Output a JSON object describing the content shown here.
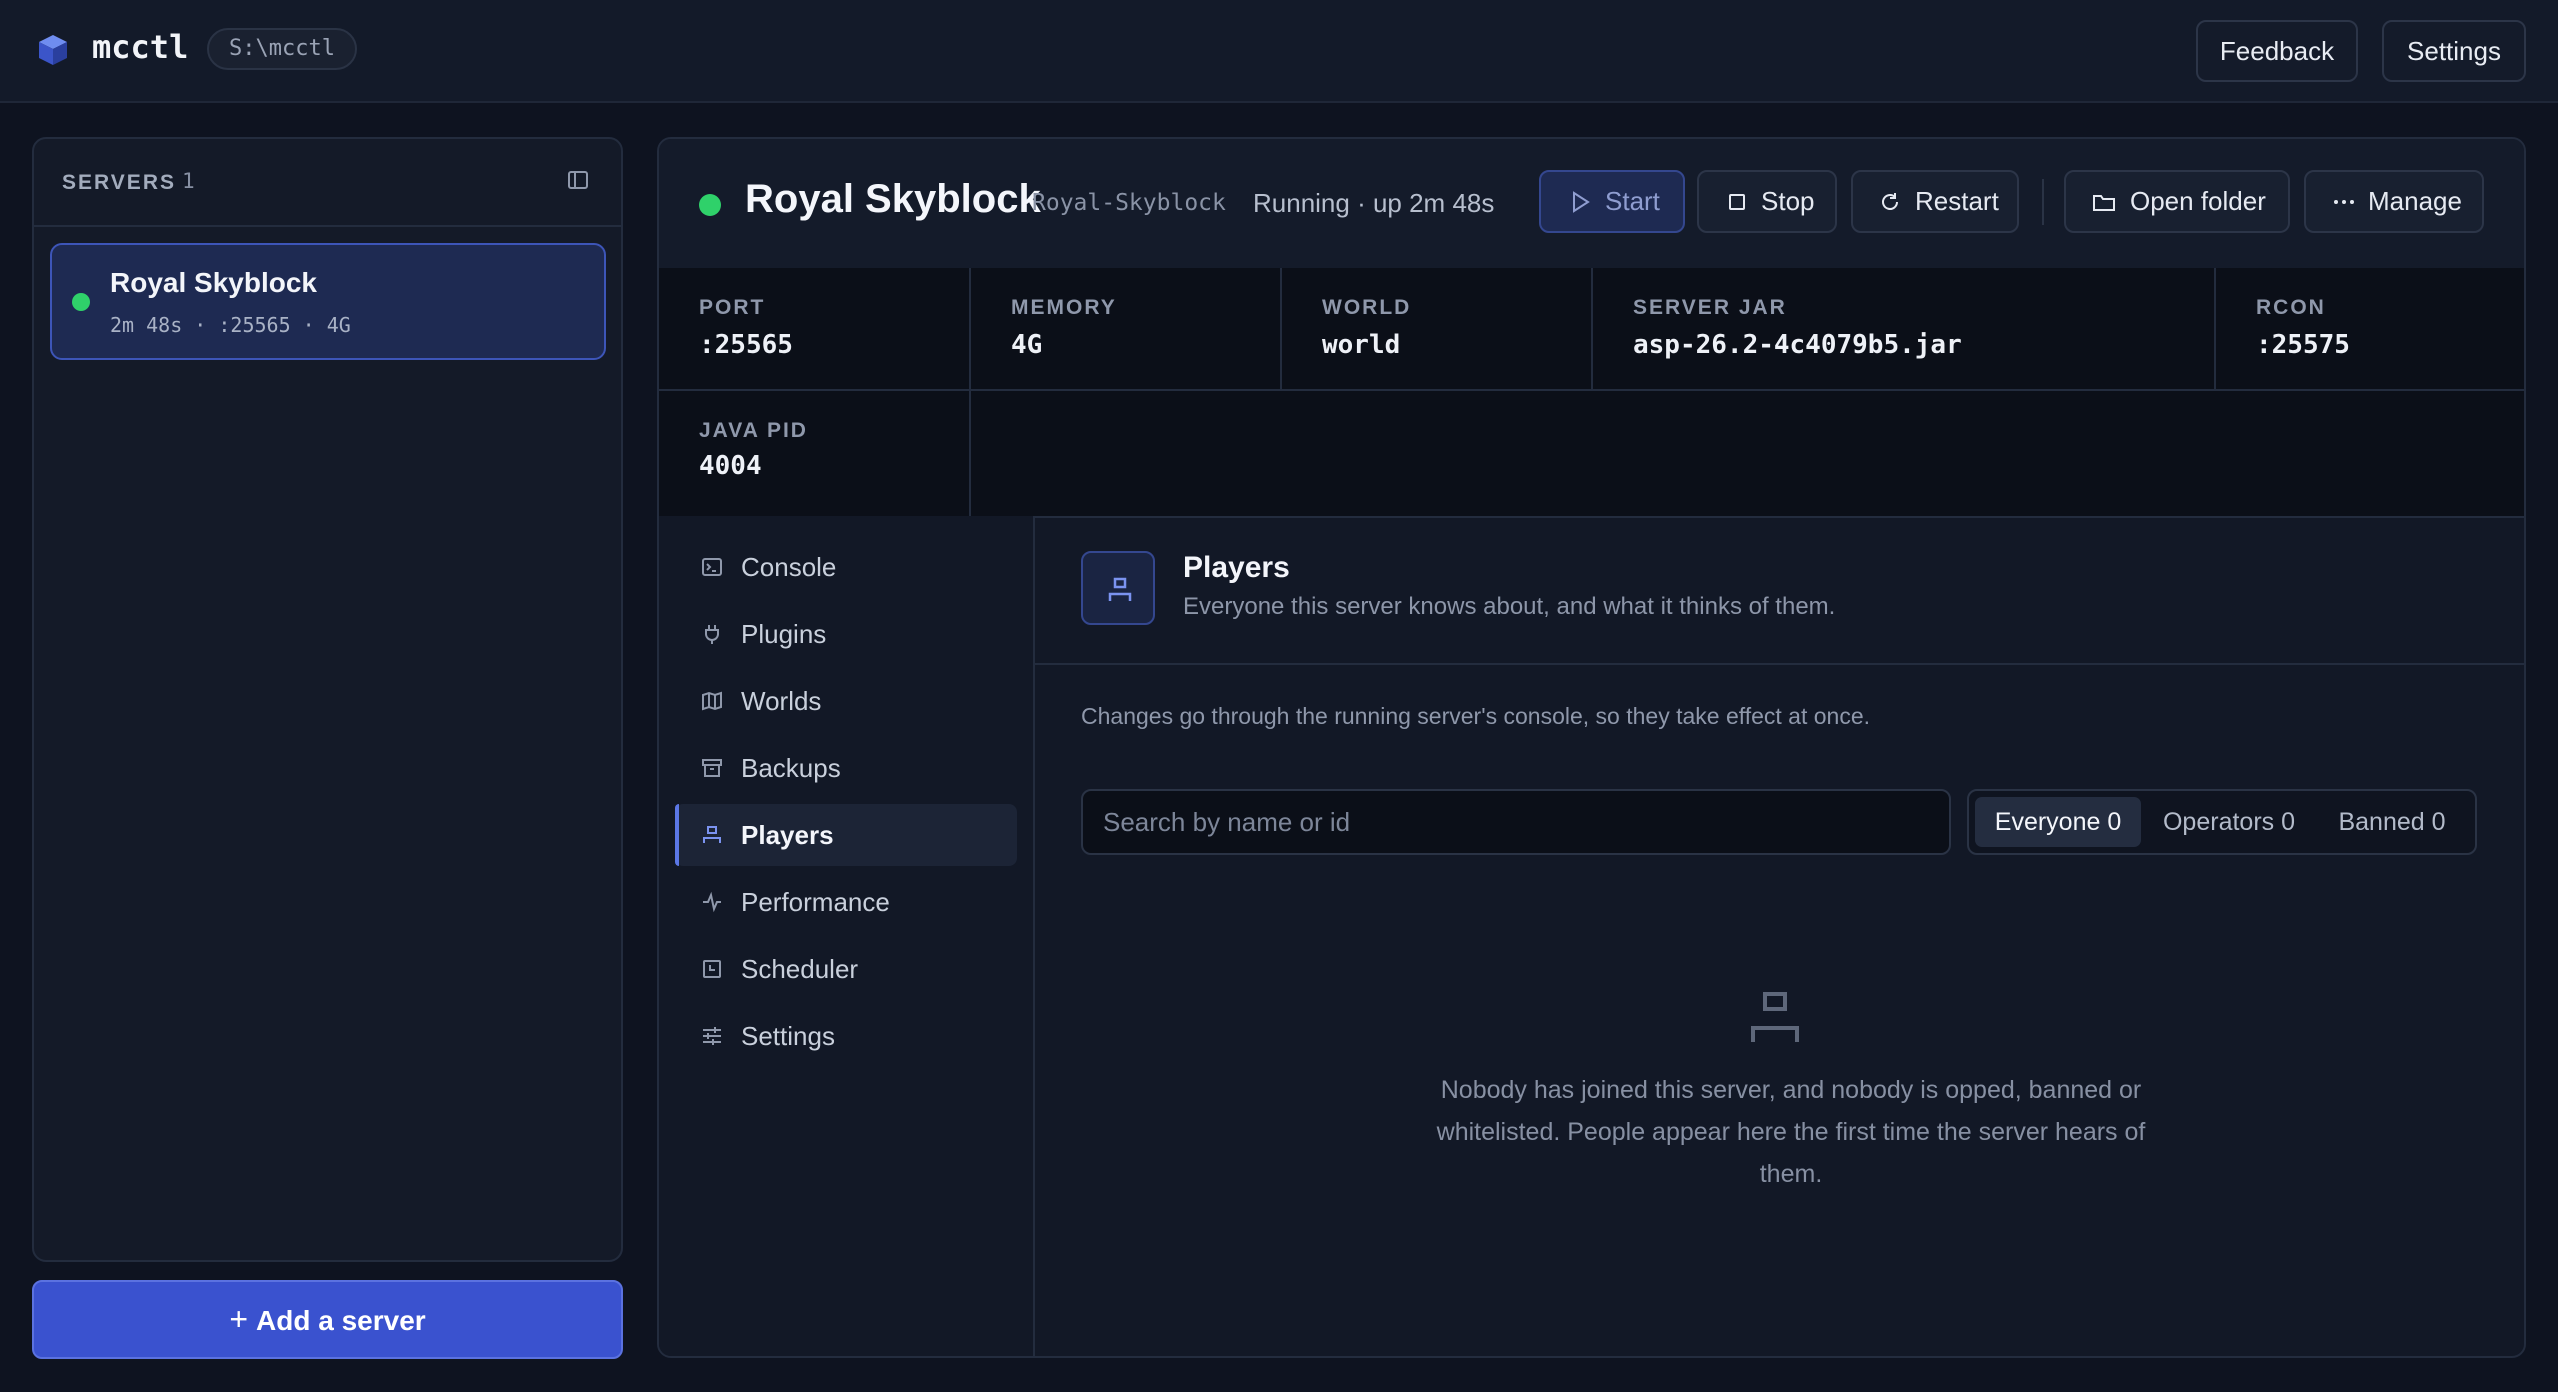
{
  "app": {
    "title": "mcctl",
    "path": "S:\\mcctl",
    "feedback_label": "Feedback",
    "settings_label": "Settings"
  },
  "sidebar": {
    "title": "SERVERS",
    "count": "1",
    "servers": [
      {
        "name": "Royal Skyblock",
        "meta": "2m 48s · :25565 · 4G",
        "status_color": "#2fd16a"
      }
    ],
    "add_label": "Add a server"
  },
  "server": {
    "name": "Royal Skyblock",
    "id": "Royal-Skyblock",
    "status": "Running · up 2m 48s",
    "actions": {
      "start": "Start",
      "stop": "Stop",
      "restart": "Restart",
      "open_folder": "Open folder",
      "manage": "Manage"
    },
    "stats": [
      {
        "label": "PORT",
        "value": ":25565"
      },
      {
        "label": "MEMORY",
        "value": "4G"
      },
      {
        "label": "WORLD",
        "value": "world"
      },
      {
        "label": "SERVER JAR",
        "value": "asp-26.2-4c4079b5.jar"
      },
      {
        "label": "RCON",
        "value": ":25575"
      },
      {
        "label": "JAVA PID",
        "value": "4004"
      }
    ]
  },
  "tabs": [
    {
      "label": "Console",
      "icon": "terminal-icon"
    },
    {
      "label": "Plugins",
      "icon": "plug-icon"
    },
    {
      "label": "Worlds",
      "icon": "map-icon"
    },
    {
      "label": "Backups",
      "icon": "archive-icon"
    },
    {
      "label": "Players",
      "icon": "user-icon",
      "active": true
    },
    {
      "label": "Performance",
      "icon": "activity-icon"
    },
    {
      "label": "Scheduler",
      "icon": "calendar-icon"
    },
    {
      "label": "Settings",
      "icon": "sliders-icon"
    }
  ],
  "players": {
    "title": "Players",
    "subtitle": "Everyone this server knows about, and what it thinks of them.",
    "note": "Changes go through the running server's console, so they take effect at once.",
    "search_placeholder": "Search by name or id",
    "filters": [
      "Everyone 0",
      "Operators 0",
      "Banned 0"
    ],
    "empty_text": "Nobody has joined this server, and nobody is opped, banned or whitelisted. People appear here the first time the server hears of them."
  },
  "colors": {
    "accent": "#3a52cf",
    "running": "#2fd16a",
    "background": "#0e1320"
  }
}
